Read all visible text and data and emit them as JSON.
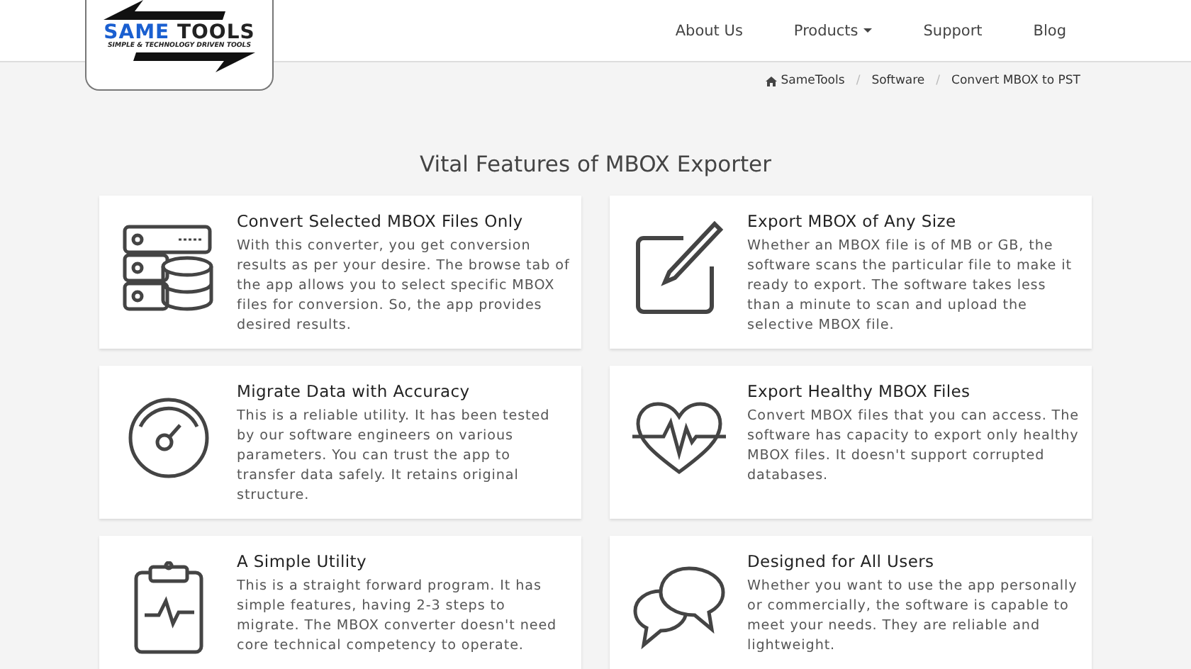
{
  "logo": {
    "word_1": "SAME",
    "word_2": "TOOLS",
    "tagline": "SIMPLE & TECHNOLOGY DRIVEN TOOLS"
  },
  "nav": [
    {
      "label": "About Us",
      "dropdown": false
    },
    {
      "label": "Products",
      "dropdown": true
    },
    {
      "label": "Support",
      "dropdown": false
    },
    {
      "label": "Blog",
      "dropdown": false
    }
  ],
  "breadcrumb": [
    "SameTools",
    "Software",
    "Convert MBOX to PST"
  ],
  "breadcrumb_separator": "/",
  "heading": "Vital Features of MBOX Exporter",
  "features": [
    {
      "title": "Convert Selected MBOX Files Only",
      "text": "With this converter, you get conversion results as per your desire. The browse tab of the app allows you to select specific MBOX files for conversion. So, the app provides desired results."
    },
    {
      "title": "Export MBOX of Any Size",
      "text": "Whether an MBOX file is of MB or GB, the software scans the particular file to make it ready to export. The software takes less than a minute to scan and upload the selective MBOX file."
    },
    {
      "title": "Migrate Data with Accuracy",
      "text": "This is a reliable utility. It has been tested by our software engineers on various parameters. You can trust the app to transfer data safely. It retains original structure."
    },
    {
      "title": "Export Healthy MBOX Files",
      "text": "Convert MBOX files that you can access. The software has capacity to export only healthy MBOX files. It doesn't support corrupted databases."
    },
    {
      "title": "A Simple Utility",
      "text": "This is a straight forward program. It has simple features, having 2-3 steps to migrate. The MBOX converter doesn't need core technical competency to operate."
    },
    {
      "title": "Designed for All Users",
      "text": "Whether you want to use the app personally or commercially, the software is capable to meet your needs. They are reliable and lightweight."
    }
  ]
}
